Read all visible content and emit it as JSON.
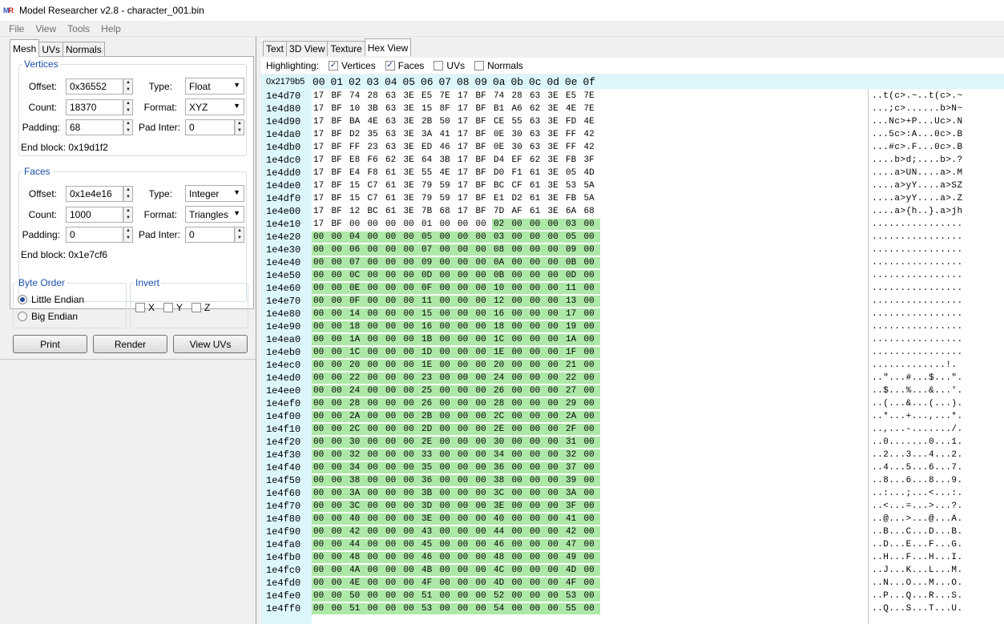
{
  "window": {
    "title": "Model Researcher v2.8 - character_001.bin",
    "logo_a": "M",
    "logo_b": "R"
  },
  "menu": [
    "File",
    "View",
    "Tools",
    "Help"
  ],
  "left_tabs": [
    "Mesh",
    "UVs",
    "Normals"
  ],
  "vertices": {
    "legend": "Vertices",
    "offset_label": "Offset:",
    "offset": "0x36552",
    "type_label": "Type:",
    "type": "Float",
    "count_label": "Count:",
    "count": "18370",
    "format_label": "Format:",
    "format": "XYZ",
    "padding_label": "Padding:",
    "padding": "68",
    "padinter_label": "Pad Inter:",
    "padinter": "0",
    "end_block": "End block: 0x19d1f2"
  },
  "faces": {
    "legend": "Faces",
    "offset_label": "Offset:",
    "offset": "0x1e4e16",
    "type_label": "Type:",
    "type": "Integer",
    "count_label": "Count:",
    "count": "1000",
    "format_label": "Format:",
    "format": "Triangles",
    "padding_label": "Padding:",
    "padding": "0",
    "padinter_label": "Pad Inter:",
    "padinter": "0",
    "end_block": "End block: 0x1e7cf6"
  },
  "byte_order": {
    "legend": "Byte Order",
    "little": "Little Endian",
    "big": "Big Endian",
    "selected": "little"
  },
  "invert": {
    "legend": "Invert",
    "x": "X",
    "y": "Y",
    "z": "Z"
  },
  "buttons": {
    "print": "Print",
    "render": "Render",
    "view_uvs": "View UVs"
  },
  "right_tabs": [
    "Text",
    "3D View",
    "Texture",
    "Hex View"
  ],
  "highlighting": {
    "label": "Highlighting:",
    "vertices": "Vertices",
    "faces": "Faces",
    "uvs": "UVs",
    "normals": "Normals",
    "vertices_checked": true,
    "faces_checked": true,
    "uvs_checked": false,
    "normals_checked": false
  },
  "hex": {
    "selection": "0x2179b5",
    "columns": [
      "00",
      "01",
      "02",
      "03",
      "04",
      "05",
      "06",
      "07",
      "08",
      "09",
      "0a",
      "0b",
      "0c",
      "0d",
      "0e",
      "0f"
    ],
    "rows": [
      {
        "addr": "1e4d70",
        "bytes": "17 BF 74 28 63 3E E5 7E 17 BF 74 28 63 3E E5 7E",
        "ascii": "..t(c>.~..t(c>.~",
        "g": 0
      },
      {
        "addr": "1e4d80",
        "bytes": "17 BF 10 3B 63 3E 15 8F 17 BF B1 A6 62 3E 4E 7E",
        "ascii": "...;c>......b>N~",
        "g": 0
      },
      {
        "addr": "1e4d90",
        "bytes": "17 BF BA 4E 63 3E 2B 50 17 BF CE 55 63 3E FD 4E",
        "ascii": "...Nc>+P...Uc>.N",
        "g": 0
      },
      {
        "addr": "1e4da0",
        "bytes": "17 BF D2 35 63 3E 3A 41 17 BF 0E 30 63 3E FF 42",
        "ascii": "...5c>:A...0c>.B",
        "g": 0
      },
      {
        "addr": "1e4db0",
        "bytes": "17 BF FF 23 63 3E ED 46 17 BF 0E 30 63 3E FF 42",
        "ascii": "...#c>.F...0c>.B",
        "g": 0
      },
      {
        "addr": "1e4dc0",
        "bytes": "17 BF E8 F6 62 3E 64 3B 17 BF D4 EF 62 3E FB 3F",
        "ascii": "....b>d;....b>.?",
        "g": 0
      },
      {
        "addr": "1e4dd0",
        "bytes": "17 BF E4 F8 61 3E 55 4E 17 BF D0 F1 61 3E 05 4D",
        "ascii": "....a>UN....a>.M",
        "g": 0
      },
      {
        "addr": "1e4de0",
        "bytes": "17 BF 15 C7 61 3E 79 59 17 BF BC CF 61 3E 53 5A",
        "ascii": "....a>yY....a>SZ",
        "g": 0
      },
      {
        "addr": "1e4df0",
        "bytes": "17 BF 15 C7 61 3E 79 59 17 BF E1 D2 61 3E FB 5A",
        "ascii": "....a>yY....a>.Z",
        "g": 0
      },
      {
        "addr": "1e4e00",
        "bytes": "17 BF 12 BC 61 3E 7B 68 17 BF 7D AF 61 3E 6A 68",
        "ascii": "....a>{h..}.a>jh",
        "g": 0
      },
      {
        "addr": "1e4e10",
        "bytes": "17 BF 00 00 00 00 01 00 00 00 02 00 00 00 03 00",
        "ascii": "................",
        "g": 6
      },
      {
        "addr": "1e4e20",
        "bytes": "00 00 04 00 00 00 05 00 00 00 03 00 00 00 05 00",
        "ascii": "................",
        "g": 16
      },
      {
        "addr": "1e4e30",
        "bytes": "00 00 06 00 00 00 07 00 00 00 08 00 00 00 09 00",
        "ascii": "................",
        "g": 16
      },
      {
        "addr": "1e4e40",
        "bytes": "00 00 07 00 00 00 09 00 00 00 0A 00 00 00 0B 00",
        "ascii": "................",
        "g": 16
      },
      {
        "addr": "1e4e50",
        "bytes": "00 00 0C 00 00 00 0D 00 00 00 0B 00 00 00 0D 00",
        "ascii": "................",
        "g": 16
      },
      {
        "addr": "1e4e60",
        "bytes": "00 00 0E 00 00 00 0F 00 00 00 10 00 00 00 11 00",
        "ascii": "................",
        "g": 16
      },
      {
        "addr": "1e4e70",
        "bytes": "00 00 0F 00 00 00 11 00 00 00 12 00 00 00 13 00",
        "ascii": "................",
        "g": 16
      },
      {
        "addr": "1e4e80",
        "bytes": "00 00 14 00 00 00 15 00 00 00 16 00 00 00 17 00",
        "ascii": "................",
        "g": 16
      },
      {
        "addr": "1e4e90",
        "bytes": "00 00 18 00 00 00 16 00 00 00 18 00 00 00 19 00",
        "ascii": "................",
        "g": 16
      },
      {
        "addr": "1e4ea0",
        "bytes": "00 00 1A 00 00 00 1B 00 00 00 1C 00 00 00 1A 00",
        "ascii": "................",
        "g": 16
      },
      {
        "addr": "1e4eb0",
        "bytes": "00 00 1C 00 00 00 1D 00 00 00 1E 00 00 00 1F 00",
        "ascii": "................",
        "g": 16
      },
      {
        "addr": "1e4ec0",
        "bytes": "00 00 20 00 00 00 1E 00 00 00 20 00 00 00 21 00",
        "ascii": ".............!.",
        "g": 16
      },
      {
        "addr": "1e4ed0",
        "bytes": "00 00 22 00 00 00 23 00 00 00 24 00 00 00 22 00",
        "ascii": "..\"...#...$...\".",
        "g": 16
      },
      {
        "addr": "1e4ee0",
        "bytes": "00 00 24 00 00 00 25 00 00 00 26 00 00 00 27 00",
        "ascii": "..$...%...&...'.",
        "g": 16
      },
      {
        "addr": "1e4ef0",
        "bytes": "00 00 28 00 00 00 26 00 00 00 28 00 00 00 29 00",
        "ascii": "..(...&...(...).",
        "g": 16
      },
      {
        "addr": "1e4f00",
        "bytes": "00 00 2A 00 00 00 2B 00 00 00 2C 00 00 00 2A 00",
        "ascii": "..*...+...,...*.",
        "g": 16
      },
      {
        "addr": "1e4f10",
        "bytes": "00 00 2C 00 00 00 2D 00 00 00 2E 00 00 00 2F 00",
        "ascii": "..,...-......./.",
        "g": 16
      },
      {
        "addr": "1e4f20",
        "bytes": "00 00 30 00 00 00 2E 00 00 00 30 00 00 00 31 00",
        "ascii": "..0.......0...1.",
        "g": 16
      },
      {
        "addr": "1e4f30",
        "bytes": "00 00 32 00 00 00 33 00 00 00 34 00 00 00 32 00",
        "ascii": "..2...3...4...2.",
        "g": 16
      },
      {
        "addr": "1e4f40",
        "bytes": "00 00 34 00 00 00 35 00 00 00 36 00 00 00 37 00",
        "ascii": "..4...5...6...7.",
        "g": 16
      },
      {
        "addr": "1e4f50",
        "bytes": "00 00 38 00 00 00 36 00 00 00 38 00 00 00 39 00",
        "ascii": "..8...6...8...9.",
        "g": 16
      },
      {
        "addr": "1e4f60",
        "bytes": "00 00 3A 00 00 00 3B 00 00 00 3C 00 00 00 3A 00",
        "ascii": "..:...;...<...:.",
        "g": 16
      },
      {
        "addr": "1e4f70",
        "bytes": "00 00 3C 00 00 00 3D 00 00 00 3E 00 00 00 3F 00",
        "ascii": "..<...=...>...?.",
        "g": 16
      },
      {
        "addr": "1e4f80",
        "bytes": "00 00 40 00 00 00 3E 00 00 00 40 00 00 00 41 00",
        "ascii": "..@...>...@...A.",
        "g": 16
      },
      {
        "addr": "1e4f90",
        "bytes": "00 00 42 00 00 00 43 00 00 00 44 00 00 00 42 00",
        "ascii": "..B...C...D...B.",
        "g": 16
      },
      {
        "addr": "1e4fa0",
        "bytes": "00 00 44 00 00 00 45 00 00 00 46 00 00 00 47 00",
        "ascii": "..D...E...F...G.",
        "g": 16
      },
      {
        "addr": "1e4fb0",
        "bytes": "00 00 48 00 00 00 46 00 00 00 48 00 00 00 49 00",
        "ascii": "..H...F...H...I.",
        "g": 16
      },
      {
        "addr": "1e4fc0",
        "bytes": "00 00 4A 00 00 00 4B 00 00 00 4C 00 00 00 4D 00",
        "ascii": "..J...K...L...M.",
        "g": 16
      },
      {
        "addr": "1e4fd0",
        "bytes": "00 00 4E 00 00 00 4F 00 00 00 4D 00 00 00 4F 00",
        "ascii": "..N...O...M...O.",
        "g": 16
      },
      {
        "addr": "1e4fe0",
        "bytes": "00 00 50 00 00 00 51 00 00 00 52 00 00 00 53 00",
        "ascii": "..P...Q...R...S.",
        "g": 16
      },
      {
        "addr": "1e4ff0",
        "bytes": "00 00 51 00 00 00 53 00 00 00 54 00 00 00 55 00",
        "ascii": "..Q...S...T...U.",
        "g": 16
      }
    ]
  },
  "colors": {
    "highlight": "#aee8a8",
    "address_bg": "#dcf6fb",
    "legend": "#1c50a8"
  }
}
